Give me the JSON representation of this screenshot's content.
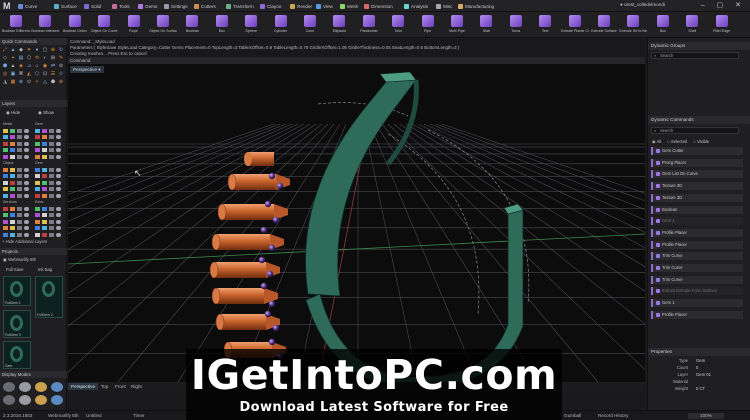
{
  "app": {
    "logo": "M"
  },
  "menu": [
    "Curve",
    "Surface",
    "Solid",
    "Tools",
    "Gems",
    "Settings",
    "Cutters",
    "Transform",
    "Clayoo",
    "Render",
    "View",
    "Mesh",
    "Dimension",
    "Analysis",
    "Misc",
    "Manufacturing"
  ],
  "user": {
    "name": "orest_colledelmondi"
  },
  "window_controls": "–  ▢  ✕",
  "toolbar": [
    "Boolean Difference",
    "Boolean Intersection",
    "Boolean Union",
    "Object On Curve",
    "Rope",
    "Object On Surface",
    "Boolean",
    "Box",
    "Sphere",
    "Cylinder",
    "Cone",
    "Ellipsoid",
    "Paraboloid",
    "Tube",
    "Pipe",
    "Multi Pipe",
    "Slab",
    "Torus",
    "Text",
    "Extrude Planar Curve",
    "Extrude Surface",
    "Extrude Srf to Nearby",
    "Bus",
    "Shell",
    "Fillet Edge"
  ],
  "command": {
    "line1": "Command: _StyleLoad",
    "line2": "Parameters ( StyleSave  StyleLoad  Category=Cutter  Gems  Placement=0  TopLength=3  TableXOffset=0.8  TableLength=0.75  GirdleXOffset=1.05  GirdleThickness=0.05  SeatLength=0.5  BottomLength=3 )",
    "line3": "Creating meshes... Press Esc to cancel",
    "prompt": "Command:"
  },
  "left": {
    "quick_commands": "Quick Commands",
    "layers": "Layers",
    "hide": "Hide",
    "show": "Show",
    "layer_groups": [
      "Metal",
      "Gem",
      "Object",
      "Gem",
      "Services",
      "Extra"
    ],
    "add_layers": "+ Hide Additional Layers",
    "projects": "Projects",
    "project_name": "Webmarlify 8th",
    "full_save": "Full Save",
    "ink_bag": "Ink Bag",
    "thumbs": [
      "FullGem 1",
      "FullGem 2",
      "FullGem 3",
      "Gem"
    ],
    "display_modes": "Display Modes"
  },
  "viewport": {
    "label": "Perspective"
  },
  "view_tabs": [
    "Perspective",
    "Top",
    "Front",
    "Right"
  ],
  "right": {
    "dynamic_groups": "Dynamic Groups",
    "search_placeholder": "Search",
    "dynamic_commands": "Dynamic Commands",
    "filters": [
      "All",
      "Selected",
      "Visible"
    ],
    "commands": [
      "Gem Cutter",
      "Prong Placer",
      "Gem List On Curve",
      "Texture 3D",
      "Texture 3D",
      "Boolean",
      "Gem 1",
      "Profile Placer",
      "Profile Placer",
      "Trim Curve",
      "Trim Curve",
      "Trim Curve",
      "Extract Extrude Form Surface",
      "Gem 1",
      "Profile Placer"
    ],
    "dim_commands": [
      6,
      12
    ],
    "properties": "Properties",
    "props": [
      {
        "label": "Type",
        "value": "Gem"
      },
      {
        "label": "Count",
        "value": "0"
      },
      {
        "label": "Layer",
        "value": "Gem 01"
      },
      {
        "label": "Material",
        "value": ""
      },
      {
        "label": "Weight",
        "value": "0 CT"
      }
    ]
  },
  "status": [
    "2.3.2016.1802",
    "Webmarlify 8th",
    "Untitled",
    "Timer",
    "Gumball",
    "Record History"
  ],
  "status_zoom": "100%",
  "watermark": {
    "main": "IGetIntoPC.com",
    "sub": "Download Latest Software for Free"
  },
  "colors": {
    "accent": "#8f6ad8",
    "ring": "#2e6b58",
    "gem_cutter": "#c8632c",
    "prong": "#4a2a7a"
  }
}
